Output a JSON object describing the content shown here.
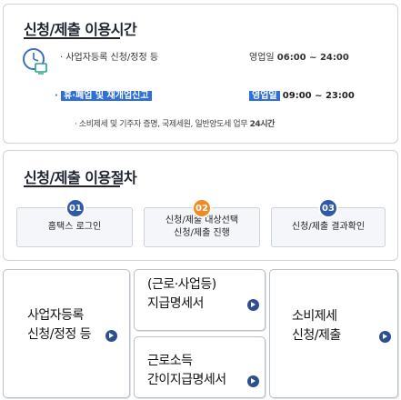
{
  "hours": {
    "title": "신청/제출 이용시간",
    "rows": [
      {
        "name": "· 사업자등록 신청/정정 등",
        "label": "영업일",
        "time": "06:00 ~ 24:00"
      },
      {
        "name": "휴·폐업 및 재개업신고",
        "label": "영업일",
        "time": "09:00 ~ 23:00"
      }
    ],
    "note_prefix": "· 소비제세 및 기주자 증명, 국제세원, 일반양도세 업무",
    "note_bold": "24시간"
  },
  "process": {
    "title": "신청/제출 이용절차",
    "steps": [
      {
        "num": "01",
        "text": "홈택스 로그인"
      },
      {
        "num": "02",
        "text": "신청/제출 대상선택",
        "text2": "신청/제출 진행"
      },
      {
        "num": "03",
        "text": "신청/제출 결과확인"
      }
    ]
  },
  "links": {
    "business_registration": {
      "line1": "사업자등록",
      "line2": "신청/정정 등"
    },
    "income_statement": {
      "line1": "(근로·사업등)",
      "line2": "지급명세서"
    },
    "earned_income": {
      "line1": "근로소득",
      "line2": "간이지급명세서"
    },
    "consumption_tax": {
      "line1": "소비제세",
      "line2": "신청/제출"
    }
  }
}
